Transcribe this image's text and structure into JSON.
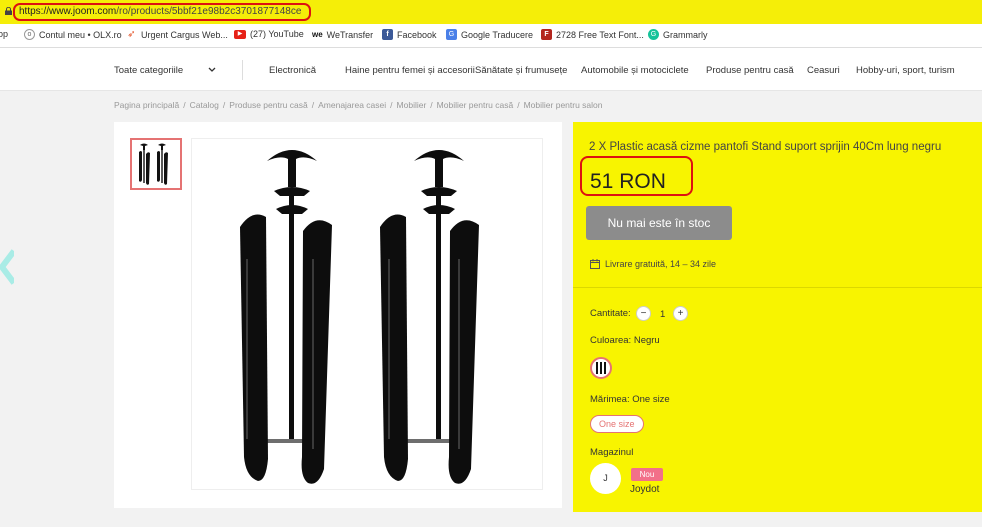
{
  "address_bar": {
    "url_scheme_host": "https://www.joom.com",
    "url_path": "/ro/products/5bbf21e98b2c3701877148ce"
  },
  "bookmarks": [
    {
      "label": "op",
      "icon": "partial-icon"
    },
    {
      "label": "Contul meu • OLX.ro",
      "icon": "olx-icon"
    },
    {
      "label": "Urgent Cargus Web...",
      "icon": "cargus-icon"
    },
    {
      "label": "(27) YouTube",
      "icon": "youtube-icon"
    },
    {
      "label": "WeTransfer",
      "icon": "wetransfer-icon"
    },
    {
      "label": "Facebook",
      "icon": "facebook-icon"
    },
    {
      "label": "Google Traducere",
      "icon": "google-translate-icon"
    },
    {
      "label": "2728 Free Text Font...",
      "icon": "font-icon"
    },
    {
      "label": "Grammarly",
      "icon": "grammarly-icon"
    }
  ],
  "nav": {
    "all_categories": "Toate categoriile",
    "items": [
      "Electronică",
      "Haine pentru femei și accesorii",
      "Sănătate și frumusețe",
      "Automobile și motociclete",
      "Produse pentru casă",
      "Ceasuri",
      "Hobby-uri, sport, turism"
    ]
  },
  "breadcrumb": [
    "Pagina principală",
    "Catalog",
    "Produse pentru casă",
    "Amenajarea casei",
    "Mobilier",
    "Mobilier pentru casă",
    "Mobilier pentru salon"
  ],
  "product": {
    "title": "2 X Plastic acasă cizme pantofi Stand suport sprijin 40Cm lung negru",
    "price": "51 RON",
    "stock_button": "Nu mai este în stoc",
    "delivery": "Livrare gratuită, 14 – 34 zile",
    "quantity_label": "Cantitate:",
    "quantity_value": "1",
    "color_label": "Culoarea: Negru",
    "size_label": "Mărimea: One size",
    "size_option": "One size",
    "shop_label": "Magazinul",
    "shop_avatar": "J",
    "shop_badge": "Nou",
    "shop_name": "Joydot"
  },
  "colors": {
    "accent_yellow": "#f8f400",
    "highlight_red": "#dd1111",
    "badge_pink": "#f27089",
    "button_gray": "#8c8c8c"
  }
}
